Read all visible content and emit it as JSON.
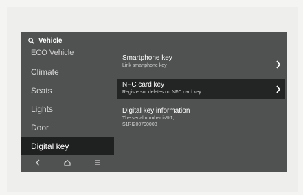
{
  "header": {
    "title": "Vehicle"
  },
  "sidebar": {
    "items": [
      {
        "label": "ECO Vehicle"
      },
      {
        "label": "Climate"
      },
      {
        "label": "Seats"
      },
      {
        "label": "Lights"
      },
      {
        "label": "Door"
      },
      {
        "label": "Digital key"
      }
    ]
  },
  "main": {
    "rows": [
      {
        "title": "Smartphone key",
        "subtitle": "Link smartphone key"
      },
      {
        "title": "NFC card key",
        "subtitle": "Registersor deletes on NFC card key."
      },
      {
        "title": "Digital key information",
        "subtitle_line1": "The serial number is%1,",
        "subtitle_line2": "S1RI200790003"
      }
    ]
  },
  "icons": {
    "search": "search-icon",
    "chevron": "chevron-right-icon",
    "back": "back-icon",
    "home": "home-icon",
    "menu": "menu-icon"
  },
  "colors": {
    "screen_bg": "#505151",
    "selected_bg": "#1f2020",
    "text": "#ffffff"
  }
}
